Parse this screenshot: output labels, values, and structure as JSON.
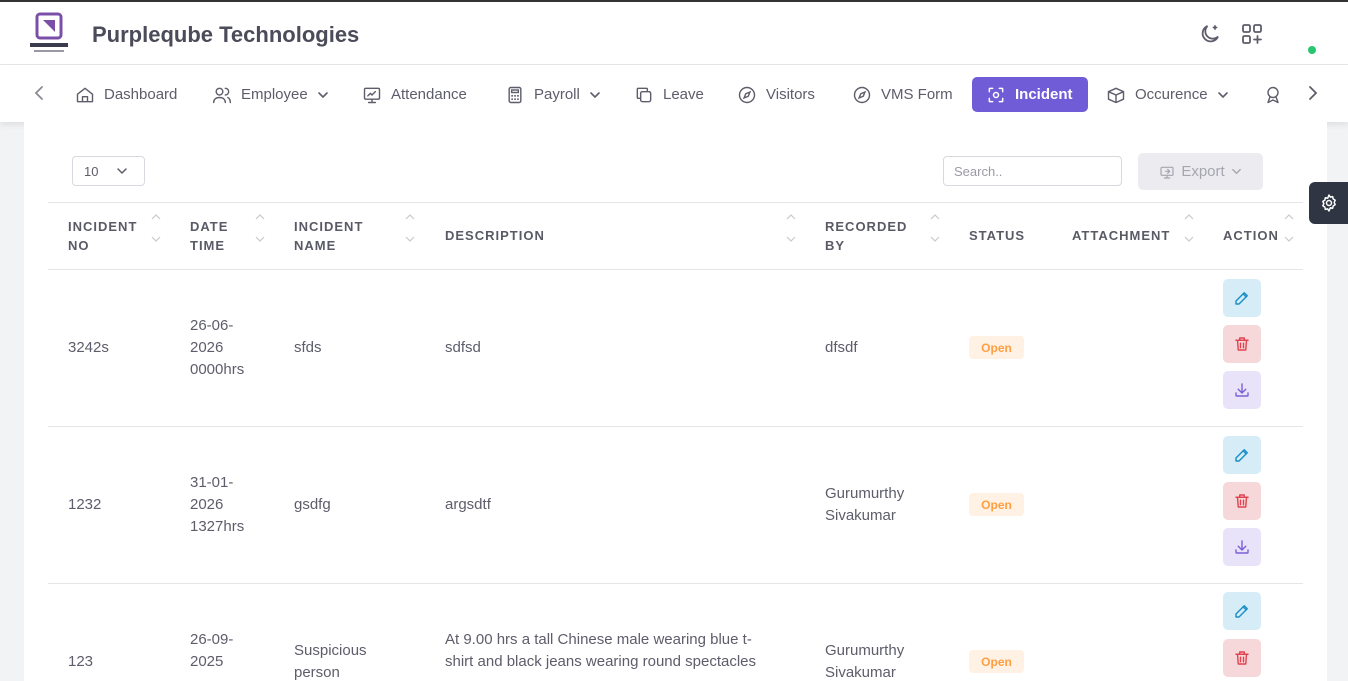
{
  "header": {
    "brand": "Purpleqube Technologies",
    "icons": [
      "moon-icon",
      "apps-add-icon"
    ],
    "status_color": "#28c76f"
  },
  "nav": {
    "items": [
      {
        "label": "Dashboard",
        "icon": "home-icon"
      },
      {
        "label": "Employee",
        "icon": "users-icon",
        "dropdown": true
      },
      {
        "label": "Attendance",
        "icon": "monitor-icon"
      },
      {
        "label": "Payroll",
        "icon": "calculator-icon",
        "dropdown": true
      },
      {
        "label": "Leave",
        "icon": "copy-icon"
      },
      {
        "label": "Visitors",
        "icon": "compass-icon"
      },
      {
        "label": "VMS Form",
        "icon": "compass-icon"
      },
      {
        "label": "Incident",
        "icon": "focus-icon",
        "active": true
      },
      {
        "label": "Occurence",
        "icon": "box-icon",
        "dropdown": true
      }
    ],
    "accent": "#6f5cd6"
  },
  "table_controls": {
    "page_length": "10",
    "search_placeholder": "Search..",
    "export_label": "Export"
  },
  "table": {
    "columns": [
      {
        "label": "Incident",
        "label2": "No"
      },
      {
        "label": "Date",
        "label2": "Time"
      },
      {
        "label": "Incident",
        "label2": "Name"
      },
      {
        "label": "Description",
        "label2": ""
      },
      {
        "label": "Recorded",
        "label2": "By"
      },
      {
        "label": "Status",
        "label2": ""
      },
      {
        "label": "Attachment",
        "label2": ""
      },
      {
        "label": "Action",
        "label2": ""
      }
    ],
    "rows": [
      {
        "incident_no": "3242s",
        "date_time": [
          "26-06-",
          "2026",
          "0000hrs"
        ],
        "incident_name": [
          "sfds"
        ],
        "description": [
          "sdfsd"
        ],
        "recorded_by": [
          "dfsdf"
        ],
        "status": "Open"
      },
      {
        "incident_no": "1232",
        "date_time": [
          "31-01-",
          "2026",
          "1327hrs"
        ],
        "incident_name": [
          "gsdfg"
        ],
        "description": [
          "argsdtf"
        ],
        "recorded_by": [
          "Gurumurthy",
          "Sivakumar"
        ],
        "status": "Open"
      },
      {
        "incident_no": "123",
        "date_time": [
          "26-09-",
          "2025"
        ],
        "incident_name": [
          "Suspicious",
          "person"
        ],
        "description": [
          "At 9.00 hrs a tall Chinese male wearing blue t-",
          "shirt and black jeans wearing round spectacles"
        ],
        "recorded_by": [
          "Gurumurthy",
          "Sivakumar"
        ],
        "status": "Open"
      }
    ],
    "status_color": "#ff9f43"
  }
}
